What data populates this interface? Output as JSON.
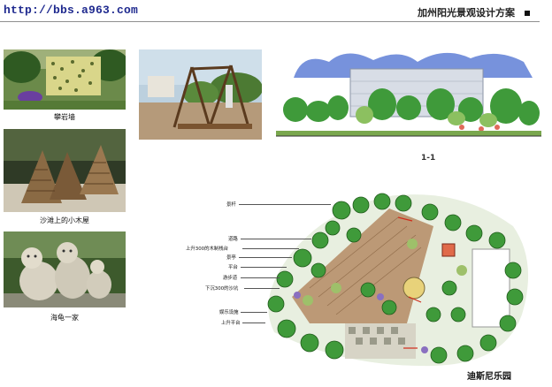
{
  "header": {
    "url": "http://bbs.a963.com",
    "title": "加州阳光景观设计方案"
  },
  "photos": {
    "climbing_wall_caption": "攀岩墙",
    "beach_hut_caption": "沙滩上的小木屋",
    "turtle_caption": "海龟一家"
  },
  "section": {
    "label": "1-1"
  },
  "plan": {
    "labels": [
      "景杆",
      "道路",
      "上升300的木制栈台",
      "景亭",
      "平台",
      "游步道",
      "下沉300的沙坑",
      "娱乐设施",
      "上升平台"
    ],
    "park_name": "迪斯尼乐园"
  },
  "colors": {
    "url": "#1f2a8f",
    "tree_green": "#3f9a3a",
    "deck_brown": "#b48a63",
    "sky_blue": "#5f7fd6"
  }
}
